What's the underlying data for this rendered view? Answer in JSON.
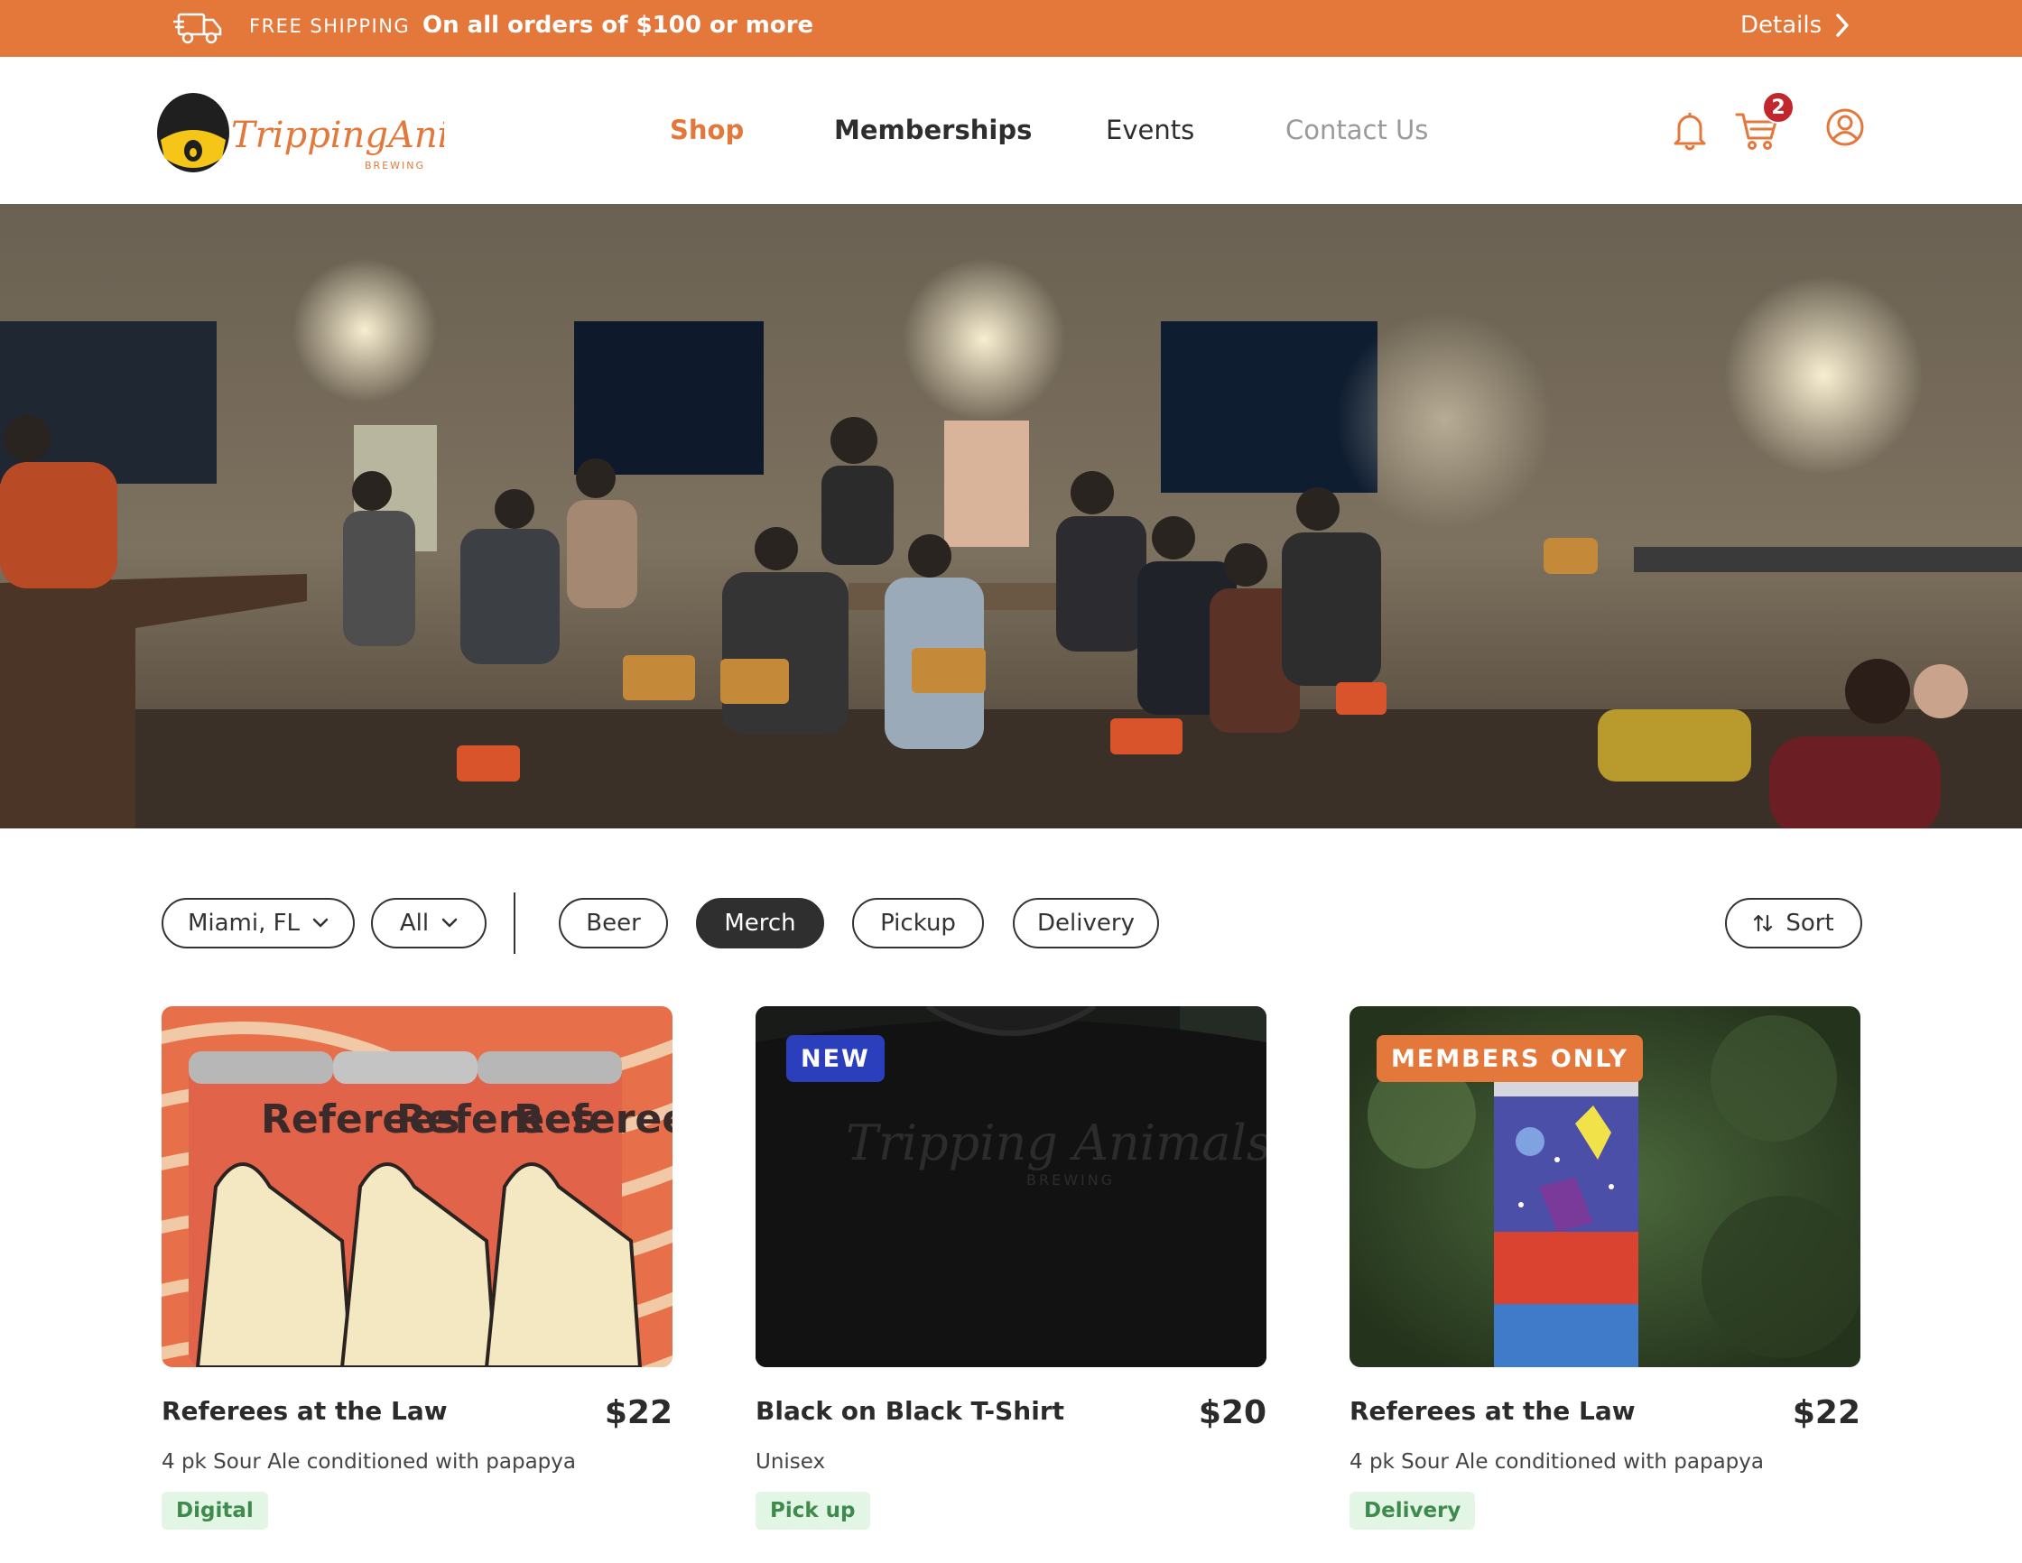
{
  "promo": {
    "label": "FREE SHIPPING",
    "message": "On all orders of $100 or more",
    "details": "Details"
  },
  "header": {
    "brand": "Tripping Animals",
    "brand_sub": "BREWING",
    "nav": {
      "shop": "Shop",
      "memberships": "Memberships",
      "events": "Events",
      "contact": "Contact Us"
    },
    "cart_count": "2"
  },
  "filters": {
    "location": "Miami, FL",
    "scope": "All",
    "chips": [
      "Beer",
      "Merch",
      "Pickup",
      "Delivery"
    ],
    "active": "Merch",
    "sort": "Sort"
  },
  "products": [
    {
      "title": "Referees at the Law",
      "price": "$22",
      "description": "4 pk Sour Ale conditioned with papapya",
      "tag": "Digital",
      "badge": "",
      "can_text": "Referees"
    },
    {
      "title": "Black on Black T-Shirt",
      "price": "$20",
      "description": "Unisex",
      "tag": "Pick up",
      "badge": "NEW",
      "shirt_brand": "Tripping Animals",
      "shirt_sub": "BREWING"
    },
    {
      "title": "Referees at the Law",
      "price": "$22",
      "description": "4 pk Sour Ale conditioned with papapya",
      "tag": "Delivery",
      "badge": "MEMBERS ONLY"
    }
  ],
  "colors": {
    "brand_orange": "#e4773a",
    "new_badge": "#2b3fbd",
    "tag_bg": "#e3f6e6",
    "tag_text": "#3f8a4d",
    "cart_badge": "#c1272d"
  },
  "icons": {
    "promo": "truck-icon",
    "details": "chevron-right-icon",
    "bell": "bell-icon",
    "cart": "cart-icon",
    "user": "user-icon",
    "dropdown": "chevron-down-icon",
    "sort": "sort-arrows-icon"
  }
}
